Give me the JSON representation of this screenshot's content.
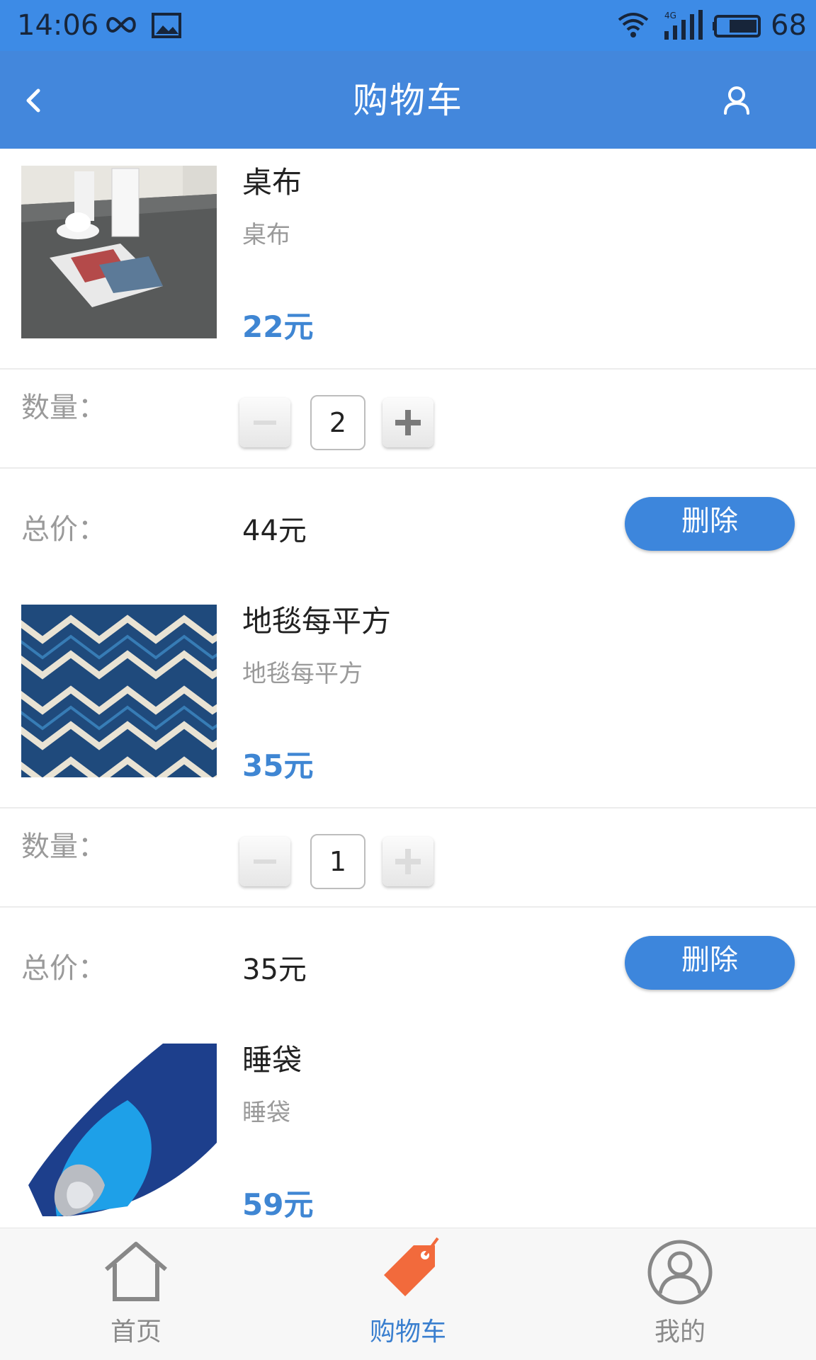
{
  "status_bar": {
    "time": "14:06",
    "battery": "68",
    "network": "4G"
  },
  "app_bar": {
    "title": "购物车"
  },
  "labels": {
    "quantity": "数量：",
    "total": "总价：",
    "delete": "删除"
  },
  "cart_items": [
    {
      "name": "桌布",
      "description": "桌布",
      "price": "22元",
      "quantity": "2",
      "total": "44元"
    },
    {
      "name": "地毯每平方",
      "description": "地毯每平方",
      "price": "35元",
      "quantity": "1",
      "total": "35元"
    },
    {
      "name": "睡袋",
      "description": "睡袋",
      "price": "59元"
    }
  ],
  "bottom_nav": [
    {
      "label": "首页",
      "icon": "home-icon",
      "active": false
    },
    {
      "label": "购物车",
      "icon": "price-tag-icon",
      "active": true
    },
    {
      "label": "我的",
      "icon": "profile-icon",
      "active": false
    }
  ],
  "colors": {
    "status_bar": "#3d8be6",
    "app_bar": "#4387dc",
    "price": "#3f86d3",
    "delete_button": "#3d86dc",
    "nav_active": "#3a7fcf",
    "nav_active_icon": "#f26a3c",
    "nav_inactive": "#8a8a8a"
  }
}
